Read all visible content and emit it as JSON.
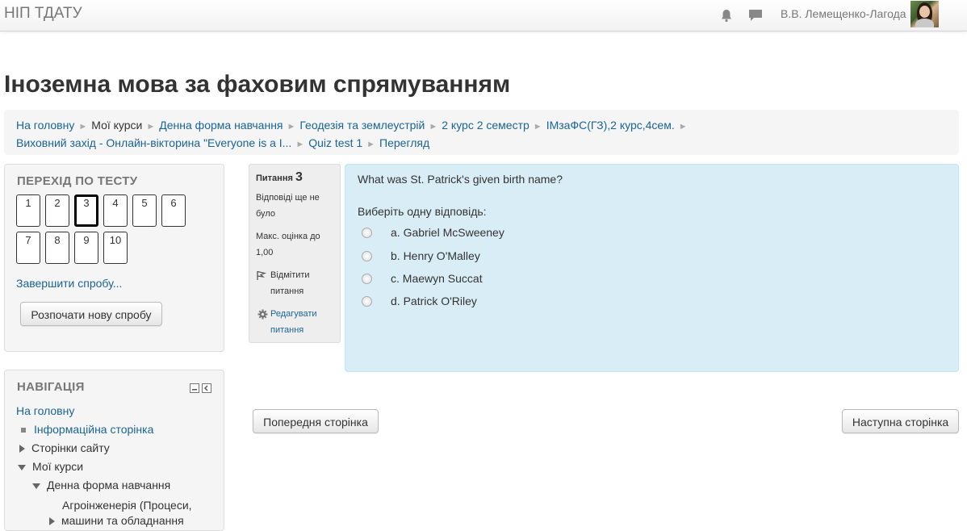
{
  "header": {
    "brand": "НІП ТДАТУ",
    "user_name": "В.В. Лемещенко-Лагода"
  },
  "page_title": "Іноземна мова за фаховим спрямуванням",
  "breadcrumb": [
    "На головну",
    "Мої курси",
    "Денна форма навчання",
    "Геодезія та землеустрій",
    "2 курс 2 семестр",
    "ІМзаФС(ГЗ),2 курс,4сем.",
    "Виховний захід - Онлайн-вікторина \"Everyone is a I...",
    "Quiz test 1",
    "Перегляд"
  ],
  "quiz_nav": {
    "title": "ПЕРЕХІД ПО ТЕСТУ",
    "questions": [
      "1",
      "2",
      "3",
      "4",
      "5",
      "6",
      "7",
      "8",
      "9",
      "10"
    ],
    "current": "3",
    "finish_link": "Завершити спробу...",
    "new_attempt_button": "Розпочати нову спробу"
  },
  "navigation": {
    "title": "НАВІГАЦІЯ",
    "home": "На головну",
    "info_page": "Інформаційна сторінка",
    "site_pages": "Сторінки сайту",
    "my_courses": "Мої курси",
    "full_time": "Денна форма навчання",
    "course_line1": "Агроінженерія (Процеси,",
    "course_line2": "машини та обладнання"
  },
  "question_info": {
    "label": "Питання",
    "number": "3",
    "status": "Відповіді ще не було",
    "max_grade": "Макс. оцінка до 1,00",
    "flag": "Відмітити питання",
    "edit": "Редагувати питання"
  },
  "question": {
    "text": "What was St. Patrick's given birth name?",
    "prompt": "Виберіть одну відповідь:",
    "answers": [
      "a. Gabriel McSweeney",
      "b. Henry O'Malley",
      "c. Maewyn Succat",
      "d. Patrick O'Riley"
    ]
  },
  "footer_nav": {
    "prev": "Попередня сторінка",
    "next": "Наступна сторінка"
  },
  "colors": {
    "link": "#1a6496",
    "question_bg": "#d9edf7",
    "block_bg": "#f5f5f5"
  }
}
